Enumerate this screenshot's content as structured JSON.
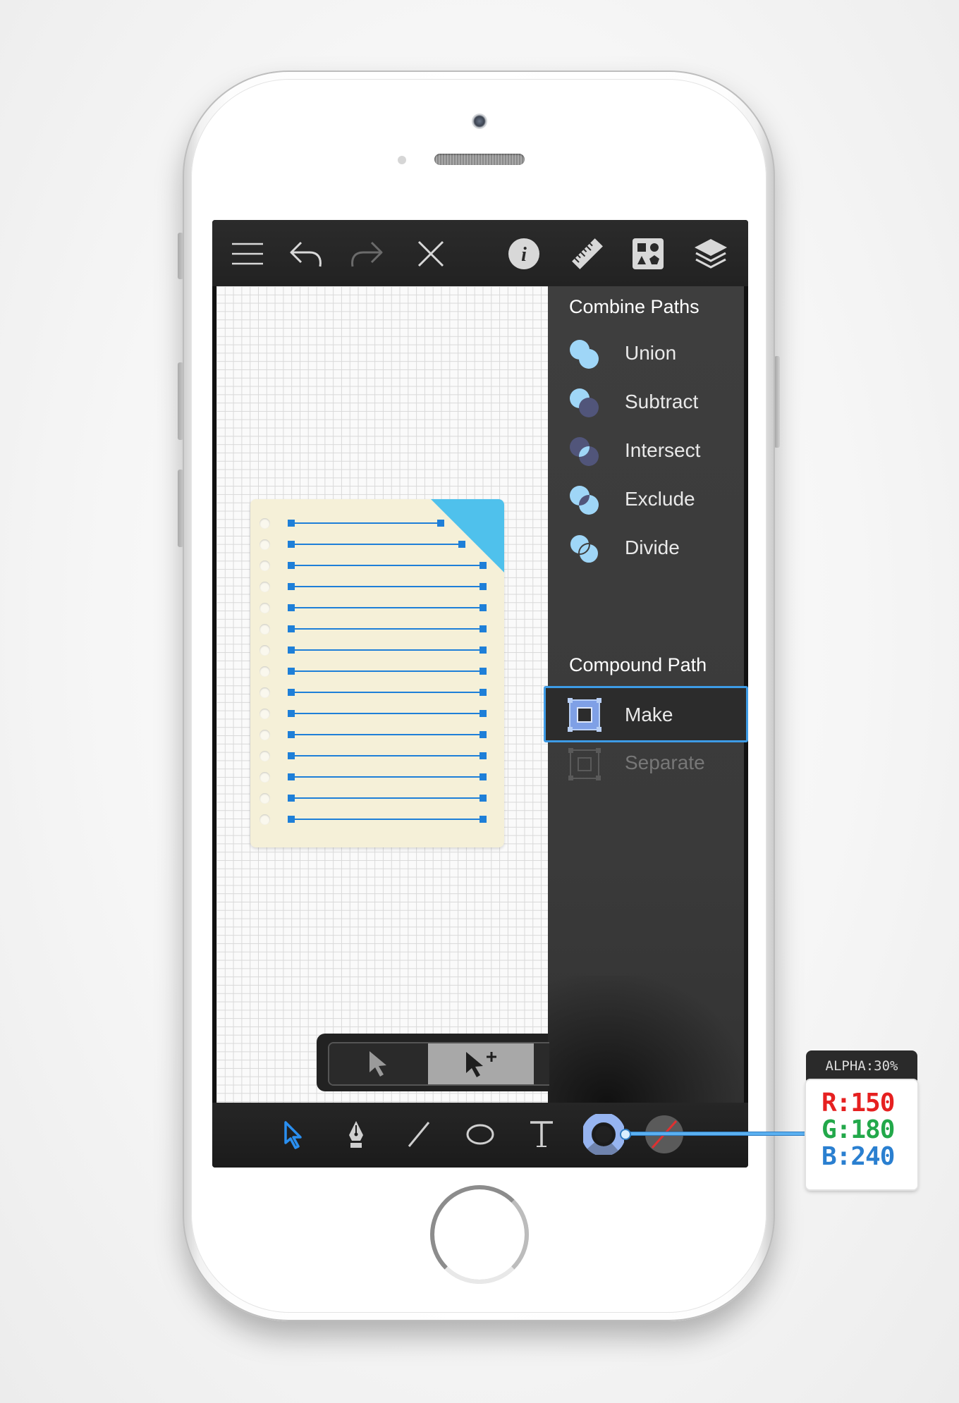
{
  "toolbar": {
    "icons": [
      "menu-icon",
      "undo-icon",
      "redo-icon",
      "close-icon",
      "info-icon",
      "ruler-icon",
      "shapes-icon",
      "layers-icon"
    ]
  },
  "panel": {
    "combine_title": "Combine Paths",
    "combine_items": [
      {
        "label": "Union"
      },
      {
        "label": "Subtract"
      },
      {
        "label": "Intersect"
      },
      {
        "label": "Exclude"
      },
      {
        "label": "Divide"
      }
    ],
    "compound_title": "Compound Path",
    "compound_items": [
      {
        "label": "Make",
        "state": "selected"
      },
      {
        "label": "Separate",
        "state": "disabled"
      }
    ]
  },
  "bottom_tools": [
    "selection-arrow-icon",
    "pen-tool-icon",
    "line-tool-icon",
    "ellipse-tool-icon",
    "text-tool-icon",
    "stroke-color-icon",
    "fill-none-icon"
  ],
  "color_callout": {
    "alpha": "ALPHA:30%",
    "r": "R:150",
    "g": "G:180",
    "b": "B:240",
    "colors": {
      "r": "#e62020",
      "g": "#22a84a",
      "b": "#2a7fd0",
      "swatch": "#96b4f0"
    }
  },
  "colors": {
    "accent": "#3d9be6",
    "note": "#f5f0d8",
    "note_corner": "#4fc1ec",
    "anchor": "#1e7fd8"
  }
}
